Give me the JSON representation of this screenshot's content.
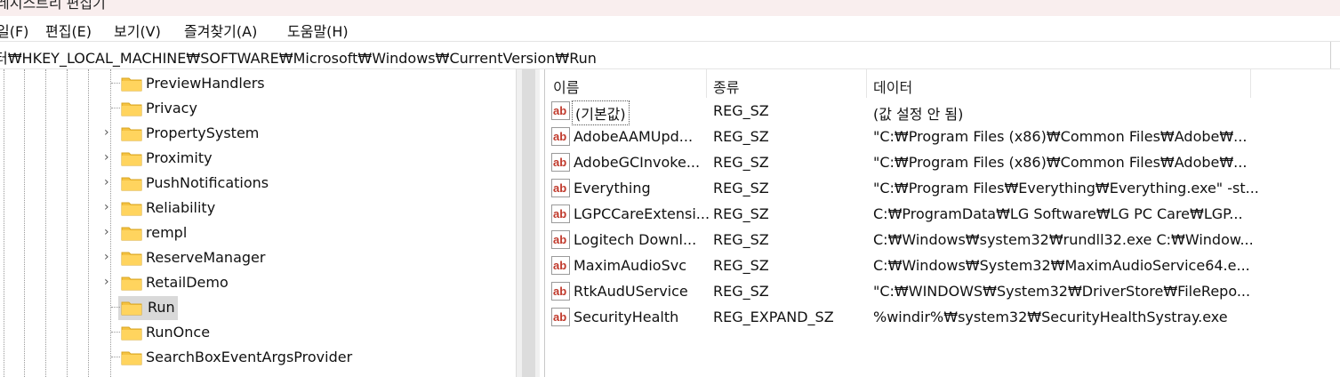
{
  "window": {
    "title": "레지스트리 편집기"
  },
  "menu": [
    {
      "label": "일(F)"
    },
    {
      "label": "편집(E)"
    },
    {
      "label": "보기(V)"
    },
    {
      "label": "즐겨찾기(A)"
    },
    {
      "label": "도움말(H)"
    }
  ],
  "address": {
    "path": "터₩HKEY_LOCAL_MACHINE₩SOFTWARE₩Microsoft₩Windows₩CurrentVersion₩Run"
  },
  "tree": {
    "items": [
      {
        "label": "PreviewHandlers",
        "expandable": false
      },
      {
        "label": "Privacy",
        "expandable": false
      },
      {
        "label": "PropertySystem",
        "expandable": true
      },
      {
        "label": "Proximity",
        "expandable": true
      },
      {
        "label": "PushNotifications",
        "expandable": true
      },
      {
        "label": "Reliability",
        "expandable": true
      },
      {
        "label": "rempl",
        "expandable": true
      },
      {
        "label": "ReserveManager",
        "expandable": true
      },
      {
        "label": "RetailDemo",
        "expandable": true
      },
      {
        "label": "Run",
        "expandable": false,
        "selected": true
      },
      {
        "label": "RunOnce",
        "expandable": false
      },
      {
        "label": "SearchBoxEventArgsProvider",
        "expandable": false
      }
    ]
  },
  "values": {
    "columns": [
      "이름",
      "종류",
      "데이터"
    ],
    "rows": [
      {
        "name": "(기본값)",
        "type": "REG_SZ",
        "data": "(값 설정 안 됨)"
      },
      {
        "name": "AdobeAAMUpd...",
        "type": "REG_SZ",
        "data": "\"C:₩Program Files (x86)₩Common Files₩Adobe₩..."
      },
      {
        "name": "AdobeGCInvoke...",
        "type": "REG_SZ",
        "data": "\"C:₩Program Files (x86)₩Common Files₩Adobe₩..."
      },
      {
        "name": "Everything",
        "type": "REG_SZ",
        "data": "\"C:₩Program Files₩Everything₩Everything.exe\" -st..."
      },
      {
        "name": "LGPCCareExtensi...",
        "type": "REG_SZ",
        "data": "C:₩ProgramData₩LG Software₩LG PC Care₩LGP..."
      },
      {
        "name": "Logitech Downl...",
        "type": "REG_SZ",
        "data": "C:₩Windows₩system32₩rundll32.exe C:₩Window..."
      },
      {
        "name": "MaximAudioSvc",
        "type": "REG_SZ",
        "data": "C:₩Windows₩System32₩MaximAudioService64.e..."
      },
      {
        "name": "RtkAudUService",
        "type": "REG_SZ",
        "data": "\"C:₩WINDOWS₩System32₩DriverStore₩FileRepo..."
      },
      {
        "name": "SecurityHealth",
        "type": "REG_EXPAND_SZ",
        "data": "%windir%₩system32₩SecurityHealthSystray.exe"
      }
    ]
  },
  "icons": {
    "folder": "folder-icon",
    "string_value": "string-value-icon",
    "chevron": "chevron-right-icon"
  },
  "colors": {
    "folder": "#f5c242",
    "selection": "#d9d9d9",
    "ab_icon": "#c0392b"
  }
}
